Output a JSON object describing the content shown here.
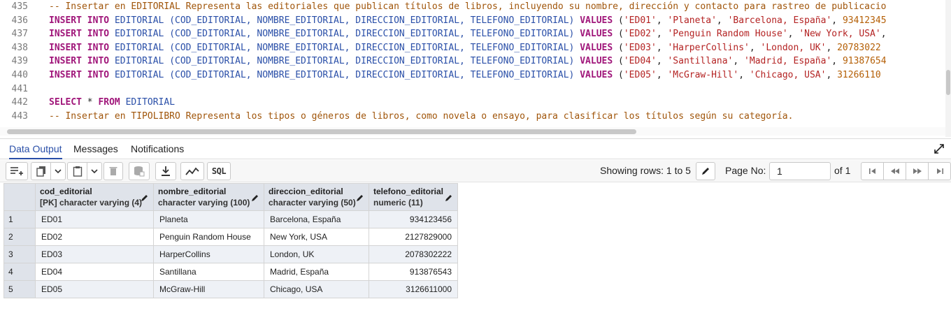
{
  "editor": {
    "lines": [
      {
        "n": "435",
        "type": "comment",
        "text": "-- Insertar en EDITORIAL Representa las editoriales que publican títulos de libros, incluyendo su nombre, dirección y contacto para rastreo de publicacio"
      },
      {
        "n": "436",
        "type": "insert",
        "cols": "(COD_EDITORIAL, NOMBRE_EDITORIAL, DIRECCION_EDITORIAL, TELEFONO_EDITORIAL)",
        "values": [
          "'ED01'",
          "'Planeta'",
          "'Barcelona, España'"
        ],
        "phone": "93412345"
      },
      {
        "n": "437",
        "type": "insert",
        "cols": "(COD_EDITORIAL, NOMBRE_EDITORIAL, DIRECCION_EDITORIAL, TELEFONO_EDITORIAL)",
        "values": [
          "'ED02'",
          "'Penguin Random House'",
          "'New York, USA'"
        ],
        "phone": ""
      },
      {
        "n": "438",
        "type": "insert",
        "cols": "(COD_EDITORIAL, NOMBRE_EDITORIAL, DIRECCION_EDITORIAL, TELEFONO_EDITORIAL)",
        "values": [
          "'ED03'",
          "'HarperCollins'",
          "'London, UK'"
        ],
        "phone": "20783022"
      },
      {
        "n": "439",
        "type": "insert",
        "cols": "(COD_EDITORIAL, NOMBRE_EDITORIAL, DIRECCION_EDITORIAL, TELEFONO_EDITORIAL)",
        "values": [
          "'ED04'",
          "'Santillana'",
          "'Madrid, España'"
        ],
        "phone": "91387654"
      },
      {
        "n": "440",
        "type": "insert",
        "cols": "(COD_EDITORIAL, NOMBRE_EDITORIAL, DIRECCION_EDITORIAL, TELEFONO_EDITORIAL)",
        "values": [
          "'ED05'",
          "'McGraw-Hill'",
          "'Chicago, USA'"
        ],
        "phone": "31266110"
      },
      {
        "n": "441",
        "type": "blank"
      },
      {
        "n": "442",
        "type": "select",
        "text": "EDITORIAL"
      },
      {
        "n": "443",
        "type": "comment",
        "text": "-- Insertar en TIPOLIBRO Representa los tipos o géneros de libros, como novela o ensayo, para clasificar los títulos según su categoría."
      }
    ],
    "keywords": {
      "insert": "INSERT",
      "into": "INTO",
      "table": "EDITORIAL",
      "values_kw": "VALUES",
      "select": "SELECT",
      "star": "*",
      "from": "FROM"
    }
  },
  "tabs": [
    {
      "label": "Data Output",
      "active": true
    },
    {
      "label": "Messages",
      "active": false
    },
    {
      "label": "Notifications",
      "active": false
    }
  ],
  "toolbar": {
    "sql_label": "SQL",
    "rows_label": "Showing rows: 1 to 5",
    "page_label": "Page No:",
    "page_value": "1",
    "of_label": "of 1"
  },
  "grid": {
    "columns": [
      {
        "name": "cod_editorial",
        "type": "[PK] character varying (4)"
      },
      {
        "name": "nombre_editorial",
        "type": "character varying (100)"
      },
      {
        "name": "direccion_editorial",
        "type": "character varying (50)"
      },
      {
        "name": "telefono_editorial",
        "type": "numeric (11)"
      }
    ],
    "rows": [
      {
        "n": "1",
        "cells": [
          "ED01",
          "Planeta",
          "Barcelona, España",
          "934123456"
        ]
      },
      {
        "n": "2",
        "cells": [
          "ED02",
          "Penguin Random House",
          "New York, USA",
          "2127829000"
        ]
      },
      {
        "n": "3",
        "cells": [
          "ED03",
          "HarperCollins",
          "London, UK",
          "2078302222"
        ]
      },
      {
        "n": "4",
        "cells": [
          "ED04",
          "Santillana",
          "Madrid, España",
          "913876543"
        ]
      },
      {
        "n": "5",
        "cells": [
          "ED05",
          "McGraw-Hill",
          "Chicago, USA",
          "3126611000"
        ]
      }
    ]
  },
  "colors": {
    "accent": "#2a4fa8",
    "keyword": "#a0167a",
    "string": "#b42323",
    "number": "#b45f06",
    "comment": "#a0550a",
    "header_bg": "#dfe3ea"
  }
}
